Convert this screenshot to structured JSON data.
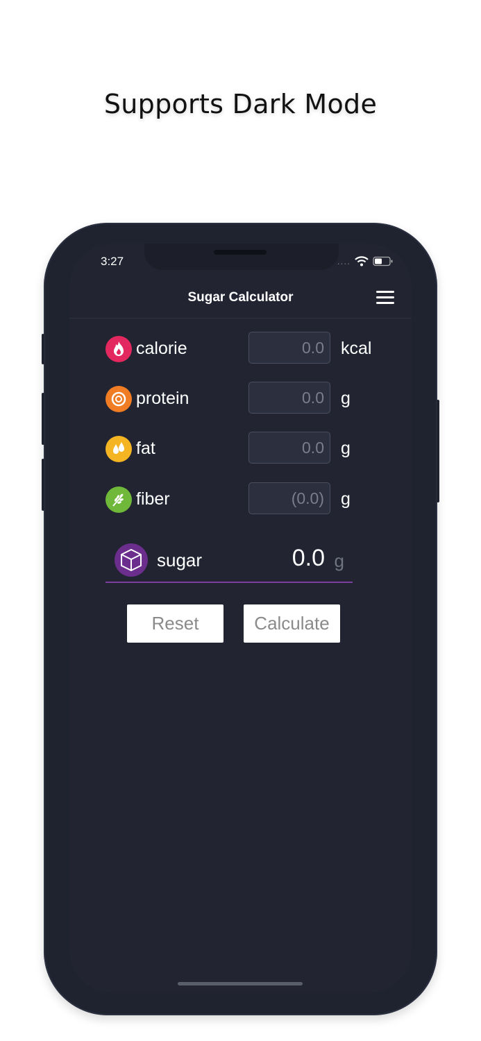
{
  "headline": "Supports Dark Mode",
  "status_bar": {
    "time": "3:27",
    "signal_dots": "....",
    "wifi_icon": "wifi-icon",
    "battery_icon": "battery-icon"
  },
  "nav": {
    "title": "Sugar Calculator",
    "menu_icon": "hamburger-menu-icon"
  },
  "nutrients": [
    {
      "label": "calorie",
      "placeholder": "0.0",
      "unit": "kcal",
      "icon": "flame-icon",
      "color": "#e3285f"
    },
    {
      "label": "protein",
      "placeholder": "0.0",
      "unit": "g",
      "icon": "protein-ring-icon",
      "color": "#f07c24"
    },
    {
      "label": "fat",
      "placeholder": "0.0",
      "unit": "g",
      "icon": "oil-drop-icon",
      "color": "#f5b422"
    },
    {
      "label": "fiber",
      "placeholder": "(0.0)",
      "unit": "g",
      "icon": "grain-icon",
      "color": "#6fb83a"
    }
  ],
  "result": {
    "label": "sugar",
    "value": "0.0",
    "unit": "g",
    "icon": "sugar-cube-icon",
    "color": "#6b2e8c"
  },
  "buttons": {
    "reset": "Reset",
    "calculate": "Calculate"
  },
  "colors": {
    "screen_bg": "#222531",
    "frame": "#1f2330",
    "accent": "#7b3f9e"
  }
}
